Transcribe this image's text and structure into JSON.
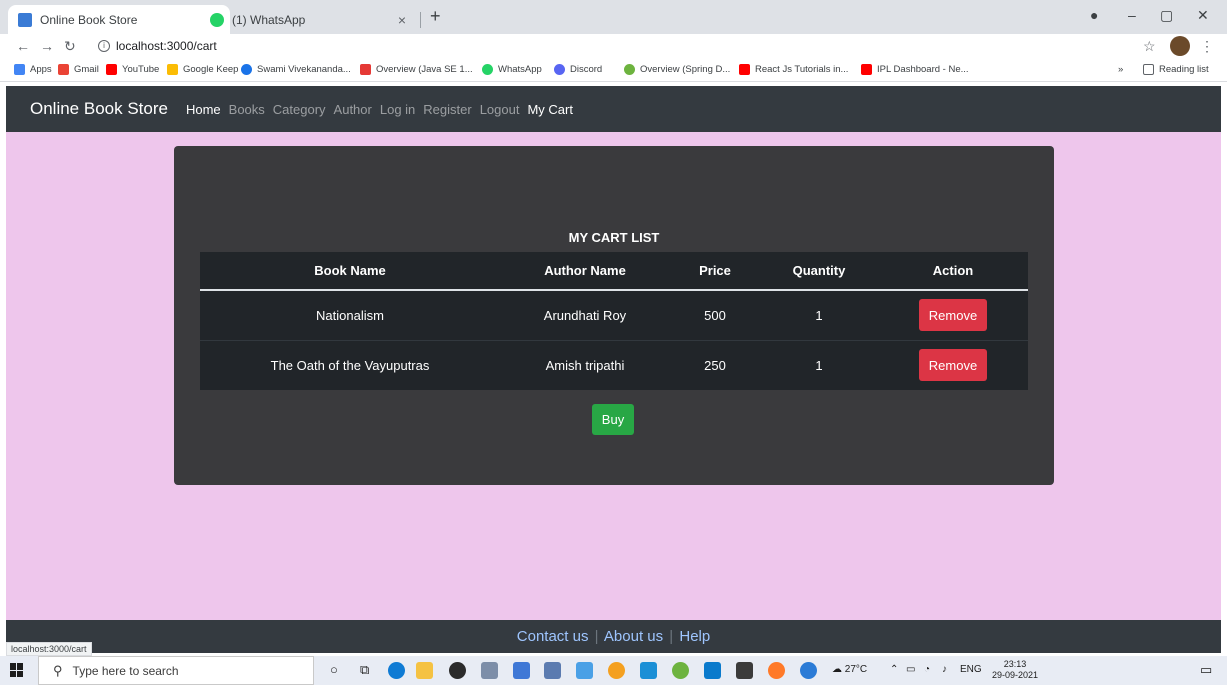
{
  "browser": {
    "tabs": [
      {
        "title": "Online Book Store",
        "active": true,
        "favicon_color": "#3a7bd5"
      },
      {
        "title": "(1) WhatsApp",
        "active": false,
        "favicon_color": "#25d366"
      }
    ],
    "close_glyph": "×",
    "new_tab_glyph": "+",
    "url": "localhost:3000/cart",
    "bookmarks": [
      {
        "label": "Apps",
        "color": "#4285f4"
      },
      {
        "label": "Gmail",
        "color": "#ea4335"
      },
      {
        "label": "YouTube",
        "color": "#ff0000"
      },
      {
        "label": "Google Keep",
        "color": "#fbbc04"
      },
      {
        "label": "Swami Vivekananda...",
        "color": "#1a73e8"
      },
      {
        "label": "Overview (Java SE 1...",
        "color": "#e53935"
      },
      {
        "label": "WhatsApp",
        "color": "#25d366"
      },
      {
        "label": "Discord",
        "color": "#5865f2"
      },
      {
        "label": "Overview (Spring D...",
        "color": "#6db33f"
      },
      {
        "label": "React Js Tutorials in...",
        "color": "#ff0000"
      },
      {
        "label": "IPL Dashboard - Ne...",
        "color": "#ff0000"
      }
    ],
    "bookmarks_overflow": "»",
    "reading_list": "Reading list",
    "status_url": "localhost:3000/cart"
  },
  "navbar": {
    "brand": "Online Book Store",
    "links": [
      {
        "label": "Home",
        "active": true
      },
      {
        "label": "Books",
        "active": false
      },
      {
        "label": "Category",
        "active": false
      },
      {
        "label": "Author",
        "active": false
      },
      {
        "label": "Log in",
        "active": false
      },
      {
        "label": "Register",
        "active": false
      },
      {
        "label": "Logout",
        "active": false
      },
      {
        "label": "My Cart",
        "active": true
      }
    ]
  },
  "cart": {
    "title": "MY CART LIST",
    "columns": [
      "Book Name",
      "Author Name",
      "Price",
      "Quantity",
      "Action"
    ],
    "rows": [
      {
        "book": "Nationalism",
        "author": "Arundhati Roy",
        "price": "500",
        "quantity": "1",
        "action": "Remove"
      },
      {
        "book": "The Oath of the Vayuputras",
        "author": "Amish tripathi",
        "price": "250",
        "quantity": "1",
        "action": "Remove"
      }
    ],
    "buy_label": "Buy"
  },
  "footer": {
    "links": [
      "Contact us",
      "About us",
      "Help"
    ],
    "separator": "|"
  },
  "taskbar": {
    "search_placeholder": "Type here to search",
    "weather": "27°C",
    "language": "ENG",
    "time": "23:13",
    "date": "29-09-2021"
  },
  "colors": {
    "page_background": "#eec6ec",
    "navbar": "#343a40",
    "card": "#3a3a3d",
    "table": "#212529",
    "remove_button": "#dc3545",
    "buy_button": "#28a745"
  }
}
